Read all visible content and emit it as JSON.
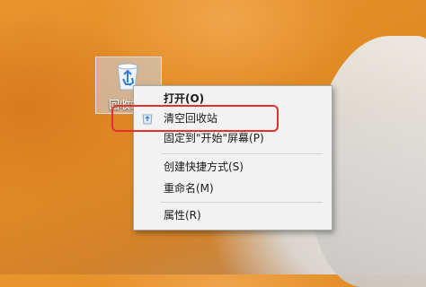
{
  "desktop_icon": {
    "label": "回收站"
  },
  "context_menu": {
    "items": [
      {
        "label": "打开(O)",
        "bold": true
      },
      {
        "label": "清空回收站",
        "icon": "recycle-bin-icon"
      },
      {
        "label": "固定到\"开始\"屏幕(P)"
      },
      {
        "label": "创建快捷方式(S)"
      },
      {
        "label": "重命名(M)"
      },
      {
        "label": "属性(R)"
      }
    ]
  },
  "annotation": {
    "highlight_color": "#e23030"
  }
}
